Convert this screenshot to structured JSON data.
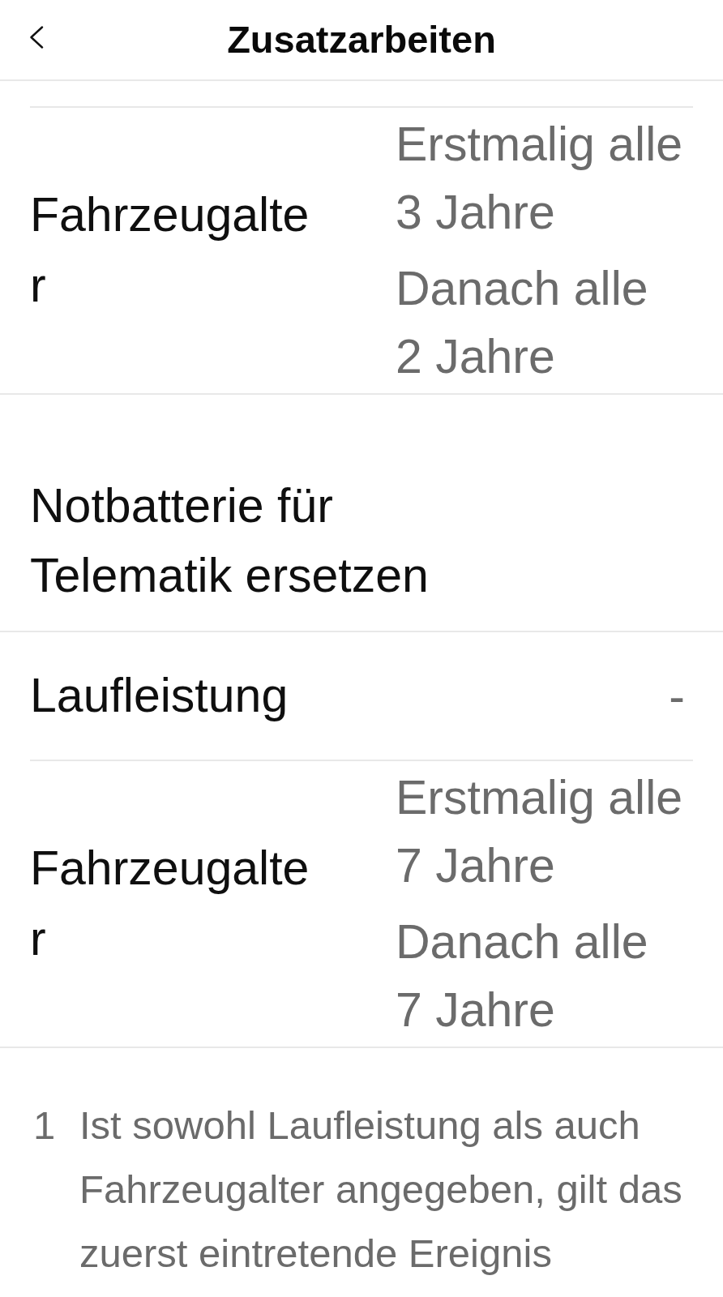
{
  "header": {
    "title": "Zusatzarbeiten"
  },
  "sections": [
    {
      "kind": "rows",
      "rows": [
        {
          "label": "Fahrzeugalter",
          "values": [
            "Erstmalig alle 3 Jahre",
            "Danach alle 2 Jahre"
          ]
        }
      ]
    },
    {
      "kind": "heading",
      "title": "Notbatterie für Telematik ersetzen"
    },
    {
      "kind": "rows",
      "rows": [
        {
          "label": "Laufleistung",
          "values": [
            "-"
          ]
        },
        {
          "label": "Fahrzeugalter",
          "values": [
            "Erstmalig alle 7 Jahre",
            "Danach alle 7 Jahre"
          ]
        }
      ]
    }
  ],
  "footnotes": [
    {
      "number": "1",
      "text": "Ist sowohl Laufleistung als auch Fahrzeugalter angegeben, gilt das zuerst eintretende Ereignis"
    }
  ]
}
